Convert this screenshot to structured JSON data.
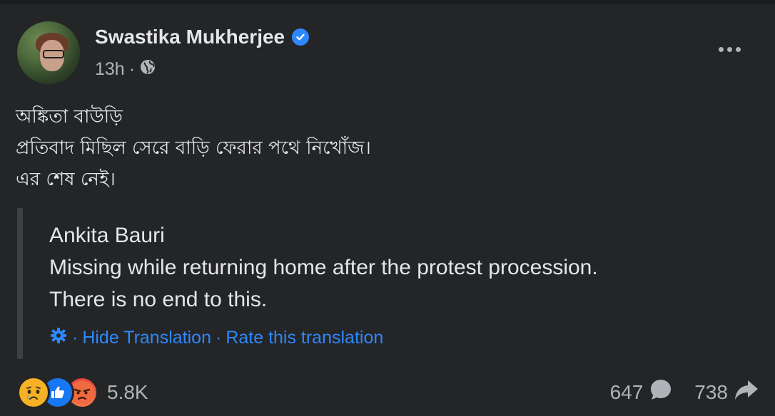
{
  "post": {
    "author": "Swastika Mukherjee",
    "time": "13h",
    "separator": "·",
    "text_lines": [
      "অঙ্কিতা বাউড়ি",
      "প্রতিবাদ মিছিল সেরে বাড়ি ফেরার পথে নিখোঁজ।",
      "এর শেষ নেই।"
    ],
    "translation_lines": [
      "Ankita Bauri",
      "Missing while returning home after the protest procession.",
      "There is no end to this."
    ],
    "translation_links": {
      "sep1": "·",
      "hide": "Hide Translation",
      "sep2": "·",
      "rate": "Rate this translation"
    }
  },
  "engagement": {
    "reaction_icons": [
      "sad-icon",
      "like-icon",
      "angry-icon"
    ],
    "reactions_count": "5.8K",
    "comments_count": "647",
    "shares_count": "738"
  },
  "colors": {
    "background": "#242526",
    "text": "#e4e6eb",
    "secondary_text": "#b0b3b8",
    "link": "#2d88ff",
    "verified": "#2d88ff"
  }
}
